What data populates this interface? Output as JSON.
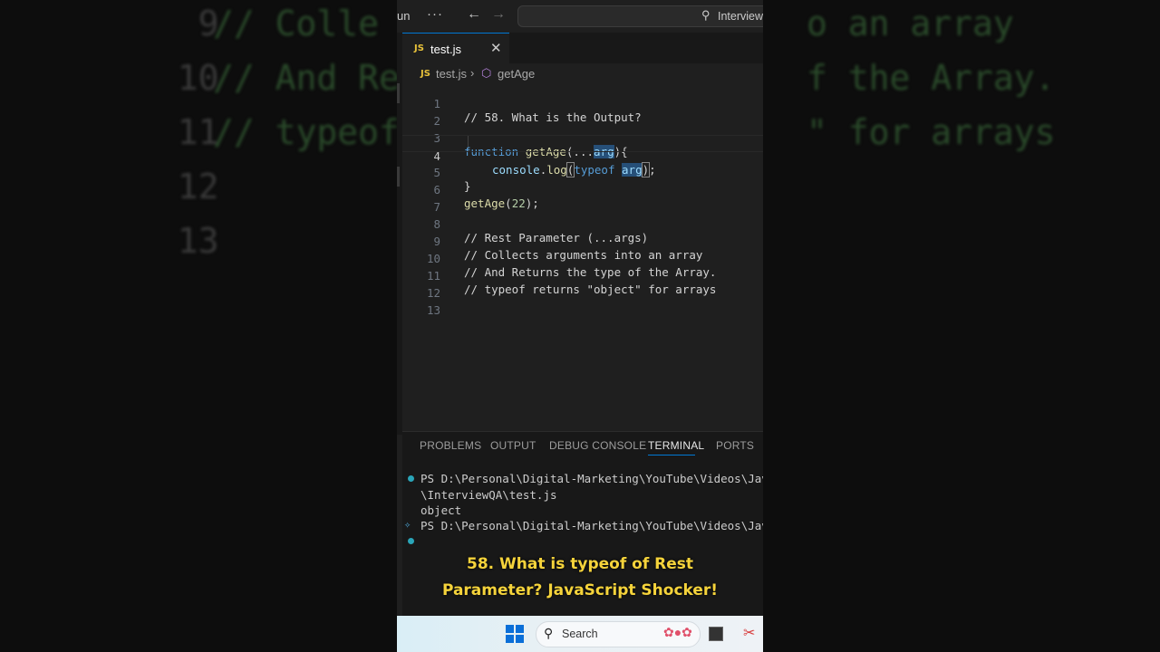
{
  "background": {
    "left_lines": [
      {
        "num": "9",
        "code": "// Colle"
      },
      {
        "num": "10",
        "code": "// And Re"
      },
      {
        "num": "11",
        "code": "// typeof"
      },
      {
        "num": "12",
        "code": ""
      },
      {
        "num": "13",
        "code": ""
      }
    ],
    "right_lines": [
      "o an array",
      "f the Array.",
      "\" for arrays"
    ]
  },
  "titlebar": {
    "run_label": "un",
    "more_label": "···",
    "search_text": "Interview"
  },
  "tab": {
    "badge": "JS",
    "label": "test.js",
    "close": "✕"
  },
  "breadcrumb": {
    "badge": "JS",
    "file": "test.js",
    "separator": "›",
    "symbol": "getAge"
  },
  "editor": {
    "line_numbers": [
      "1",
      "2",
      "3",
      "4",
      "5",
      "6",
      "7",
      "8",
      "9",
      "10",
      "11",
      "12",
      "13"
    ],
    "current_line": 4,
    "comments": {
      "l1": "// 58. What is the Output?",
      "l8": "// Rest Parameter (...args)",
      "l9": "// Collects arguments into an array",
      "l10": "// And Returns the type of the Array.",
      "l11": "// typeof returns \"object\" for arrays"
    },
    "l3": {
      "kw": "function",
      "fn": "getAge",
      "open": "(...",
      "param": "arg",
      "close": "){"
    },
    "l4": {
      "obj": "console",
      "dot": ".",
      "fn": "log",
      "open": "(",
      "kw": "typeof",
      "sp": " ",
      "a": "a",
      "rg": "rg",
      "close": ")",
      "semi": ";"
    },
    "l5": {
      "text": "}"
    },
    "l6": {
      "fn": "getAge",
      "open": "(",
      "num": "22",
      "close": ");"
    }
  },
  "panel": {
    "tabs": [
      "PROBLEMS",
      "OUTPUT",
      "DEBUG CONSOLE",
      "TERMINAL",
      "PORTS"
    ],
    "active_tab": "TERMINAL"
  },
  "terminal": {
    "lines": [
      "PS D:\\Personal\\Digital-Marketing\\YouTube\\Videos\\Java",
      "\\InterviewQA\\test.js",
      "object",
      "PS D:\\Personal\\Digital-Marketing\\YouTube\\Videos\\Java"
    ],
    "dot_color": "#2aa5b8"
  },
  "caption": {
    "line1": "58. What is typeof of Rest",
    "line2": "Parameter? JavaScript Shocker!"
  },
  "taskbar": {
    "search_label": "Search",
    "accent": "#0a6fd8"
  }
}
